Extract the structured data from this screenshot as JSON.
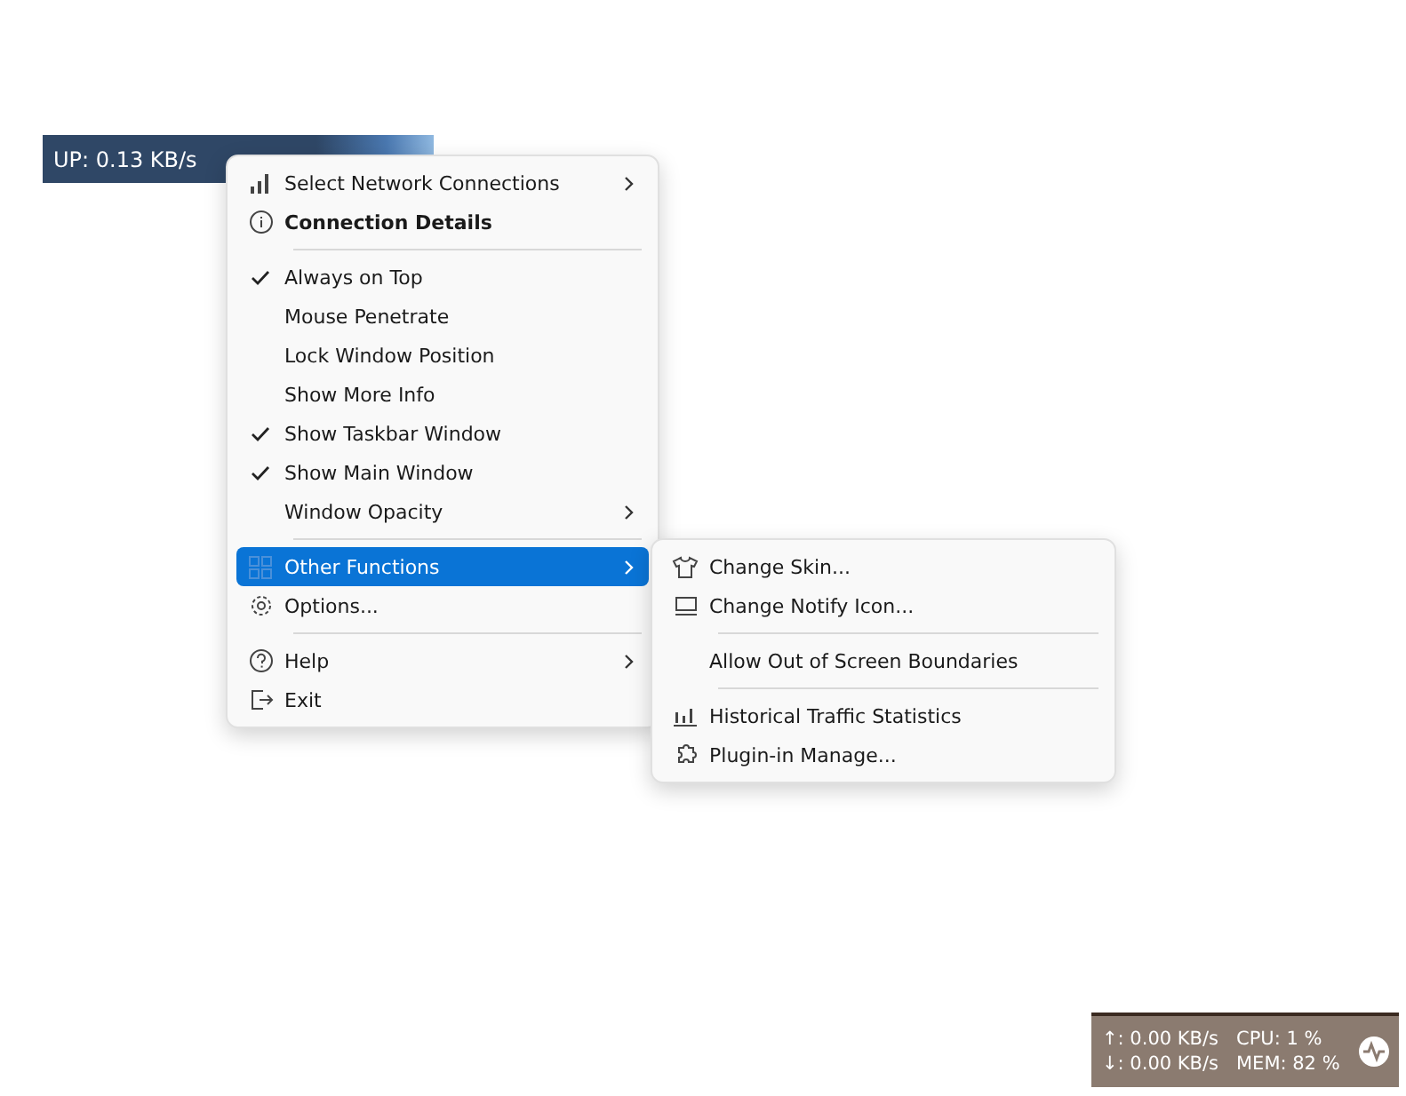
{
  "speed_window": {
    "upload": "UP: 0.13 KB/s"
  },
  "context_menu": {
    "items": [
      {
        "kind": "signal",
        "label": "Select Network Connections",
        "checked": false,
        "bold": false,
        "submenu": true,
        "selected": false
      },
      {
        "kind": "info",
        "label": "Connection Details",
        "checked": false,
        "bold": true,
        "submenu": false,
        "selected": false
      },
      {
        "kind": "separator"
      },
      {
        "kind": "plain",
        "label": "Always on Top",
        "checked": true,
        "bold": false,
        "submenu": false,
        "selected": false
      },
      {
        "kind": "plain",
        "label": "Mouse Penetrate",
        "checked": false,
        "bold": false,
        "submenu": false,
        "selected": false
      },
      {
        "kind": "plain",
        "label": "Lock Window Position",
        "checked": false,
        "bold": false,
        "submenu": false,
        "selected": false
      },
      {
        "kind": "plain",
        "label": "Show More Info",
        "checked": false,
        "bold": false,
        "submenu": false,
        "selected": false
      },
      {
        "kind": "plain",
        "label": "Show Taskbar Window",
        "checked": true,
        "bold": false,
        "submenu": false,
        "selected": false
      },
      {
        "kind": "plain",
        "label": "Show Main Window",
        "checked": true,
        "bold": false,
        "submenu": false,
        "selected": false
      },
      {
        "kind": "plain",
        "label": "Window Opacity",
        "checked": false,
        "bold": false,
        "submenu": true,
        "selected": false
      },
      {
        "kind": "separator"
      },
      {
        "kind": "grid",
        "label": "Other Functions",
        "checked": false,
        "bold": false,
        "submenu": true,
        "selected": true
      },
      {
        "kind": "settings",
        "label": "Options...",
        "checked": false,
        "bold": false,
        "submenu": false,
        "selected": false
      },
      {
        "kind": "separator"
      },
      {
        "kind": "help",
        "label": "Help",
        "checked": false,
        "bold": false,
        "submenu": true,
        "selected": false
      },
      {
        "kind": "exit",
        "label": "Exit",
        "checked": false,
        "bold": false,
        "submenu": false,
        "selected": false
      }
    ]
  },
  "submenu": {
    "items": [
      {
        "kind": "shirt",
        "label": "Change Skin..."
      },
      {
        "kind": "monitor",
        "label": "Change Notify Icon..."
      },
      {
        "kind": "separator"
      },
      {
        "kind": "plain",
        "label": "Allow Out of Screen Boundaries"
      },
      {
        "kind": "separator"
      },
      {
        "kind": "chart",
        "label": "Historical Traffic Statistics"
      },
      {
        "kind": "puzzle",
        "label": "Plugin-in Manage..."
      }
    ]
  },
  "taskbar_window": {
    "upload": "↑: 0.00 KB/s",
    "download": "↓: 0.00 KB/s",
    "cpu": "CPU: 1 %",
    "memory": "MEM: 82 %"
  }
}
